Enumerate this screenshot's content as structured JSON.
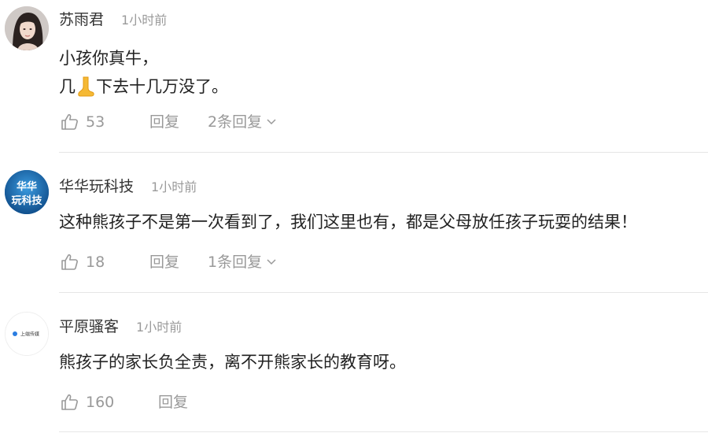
{
  "comments": [
    {
      "username": "苏雨君",
      "time": "1小时前",
      "text_line1": "小孩你真牛，",
      "text_line2_before": "几",
      "text_line2_after": "下去十几万没了。",
      "likes": "53",
      "reply_label": "回复",
      "more_replies": "2条回复",
      "avatar_icon": "woman-portrait"
    },
    {
      "username": "华华玩科技",
      "time": "1小时前",
      "text": "这种熊孩子不是第一次看到了，我们这里也有，都是父母放任孩子玩耍的结果！",
      "likes": "18",
      "reply_label": "回复",
      "more_replies": "1条回复",
      "avatar_text_top": "华华",
      "avatar_text_bottom": "玩科技"
    },
    {
      "username": "平原骚客",
      "time": "1小时前",
      "text": "熊孩子的家长负全责，离不开熊家长的教育呀。",
      "likes": "160",
      "reply_label": "回复",
      "avatar_text": "上端传媒"
    }
  ],
  "colors": {
    "username": "#333333",
    "meta": "#999999",
    "body": "#222222",
    "divider": "#e6e6e6",
    "emoji_foot": "#f5a623"
  },
  "icons": {
    "like": "thumbs-up-icon",
    "chevron": "chevron-down-icon",
    "emoji": "foot-emoji-icon"
  }
}
